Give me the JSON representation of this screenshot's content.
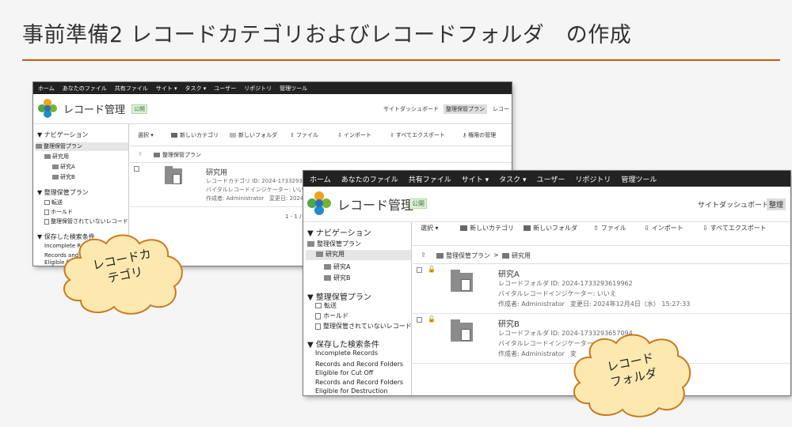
{
  "slide": {
    "title": "事前準備2 レコードカテゴリおよびレコードフォルダ　の作成"
  },
  "s1": {
    "menu": [
      "ホーム",
      "あなたのファイル",
      "共有ファイル",
      "サイト ▾",
      "タスク ▾",
      "ユーザー",
      "リポジトリ",
      "管理ツール"
    ],
    "site": "レコード管理",
    "badge": "公開",
    "links": [
      "サイトダッシュボード",
      "整理保管プラン",
      "レコー"
    ],
    "nav": {
      "nav_header": "▼ ナビゲーション",
      "plan": "整理保管プラン",
      "kenkyu": "研究用",
      "a": "研究A",
      "b": "研究B",
      "plan2_header": "▼ 整理保管プラン",
      "transfer": "転送",
      "hold": "ホールド",
      "unfiled": "整理保管されていないレコード",
      "saved_header": "▼ 保存した検索条件",
      "incomplete": "Incomplete Records",
      "cutoff_1": "Records and Record",
      "cutoff_2": "Eligible for"
    },
    "toolbar": {
      "select": "選択 ▾",
      "new_cat": "新しいカテゴリ",
      "new_folder": "新しいフォルダ",
      "file": "ファイル",
      "import": "インポート",
      "export": "すべてエクスポート",
      "perm": "権限の管理"
    },
    "crumb": "整理保管プラン",
    "item": {
      "title": "研究用",
      "id": "レコードカテゴリ ID: 2024-1733293561",
      "vital": "バイタルレコードインジケーター: いいえ",
      "creator": "作成者: Administrator",
      "modified": "変更日: 2024年"
    },
    "pager": "1 - 1 /"
  },
  "s2": {
    "menu": [
      "ホーム",
      "あなたのファイル",
      "共有ファイル",
      "サイト ▾",
      "タスク ▾",
      "ユーザー",
      "リポジトリ",
      "管理ツール"
    ],
    "site": "レコード管理",
    "badge": "公開",
    "links": [
      "サイトダッシュボード",
      "整理"
    ],
    "nav": {
      "nav_header": "▼ ナビゲーション",
      "plan": "整理保管プラン",
      "kenkyu": "研究用",
      "a": "研究A",
      "b": "研究B",
      "plan2_header": "▼ 整理保管プラン",
      "transfer": "転送",
      "hold": "ホールド",
      "unfiled": "整理保管されていないレコード",
      "saved_header": "▼ 保存した検索条件",
      "incomplete": "Incomplete Records",
      "cutoff_1": "Records and Record Folders",
      "cutoff_2": "Eligible for Cut Off",
      "destr_1": "Records and Record Folders",
      "destr_2": "Eligible for Destruction"
    },
    "toolbar": {
      "select": "選択 ▾",
      "new_cat": "新しいカテゴリ",
      "new_folder": "新しいフォルダ",
      "file": "ファイル",
      "import": "インポート",
      "export": "すべてエクスポート"
    },
    "crumb1": "整理保管プラン",
    "crumb_sep": ">",
    "crumb2": "研究用",
    "items": [
      {
        "title": "研究A",
        "id": "レコードフォルダ ID: 2024-1733293619962",
        "vital": "バイタルレコードインジケーター: いいえ",
        "creator": "作成者: Administrator",
        "modified": "変更日: 2024年12月4日（水） 15:27:33"
      },
      {
        "title": "研究B",
        "id": "レコードフォルダ ID: 2024-1733293657094",
        "vital": "バイタルレコードインジケーター: いいえ",
        "creator": "作成者: Administrator",
        "modified": "変"
      }
    ]
  },
  "cloud1": {
    "line1": "レコードカ",
    "line2": "テゴリ",
    "color": "#fde9b0"
  },
  "cloud2": {
    "line1": "レコード",
    "line2": "フォルダ",
    "color": "#fde9b0"
  }
}
